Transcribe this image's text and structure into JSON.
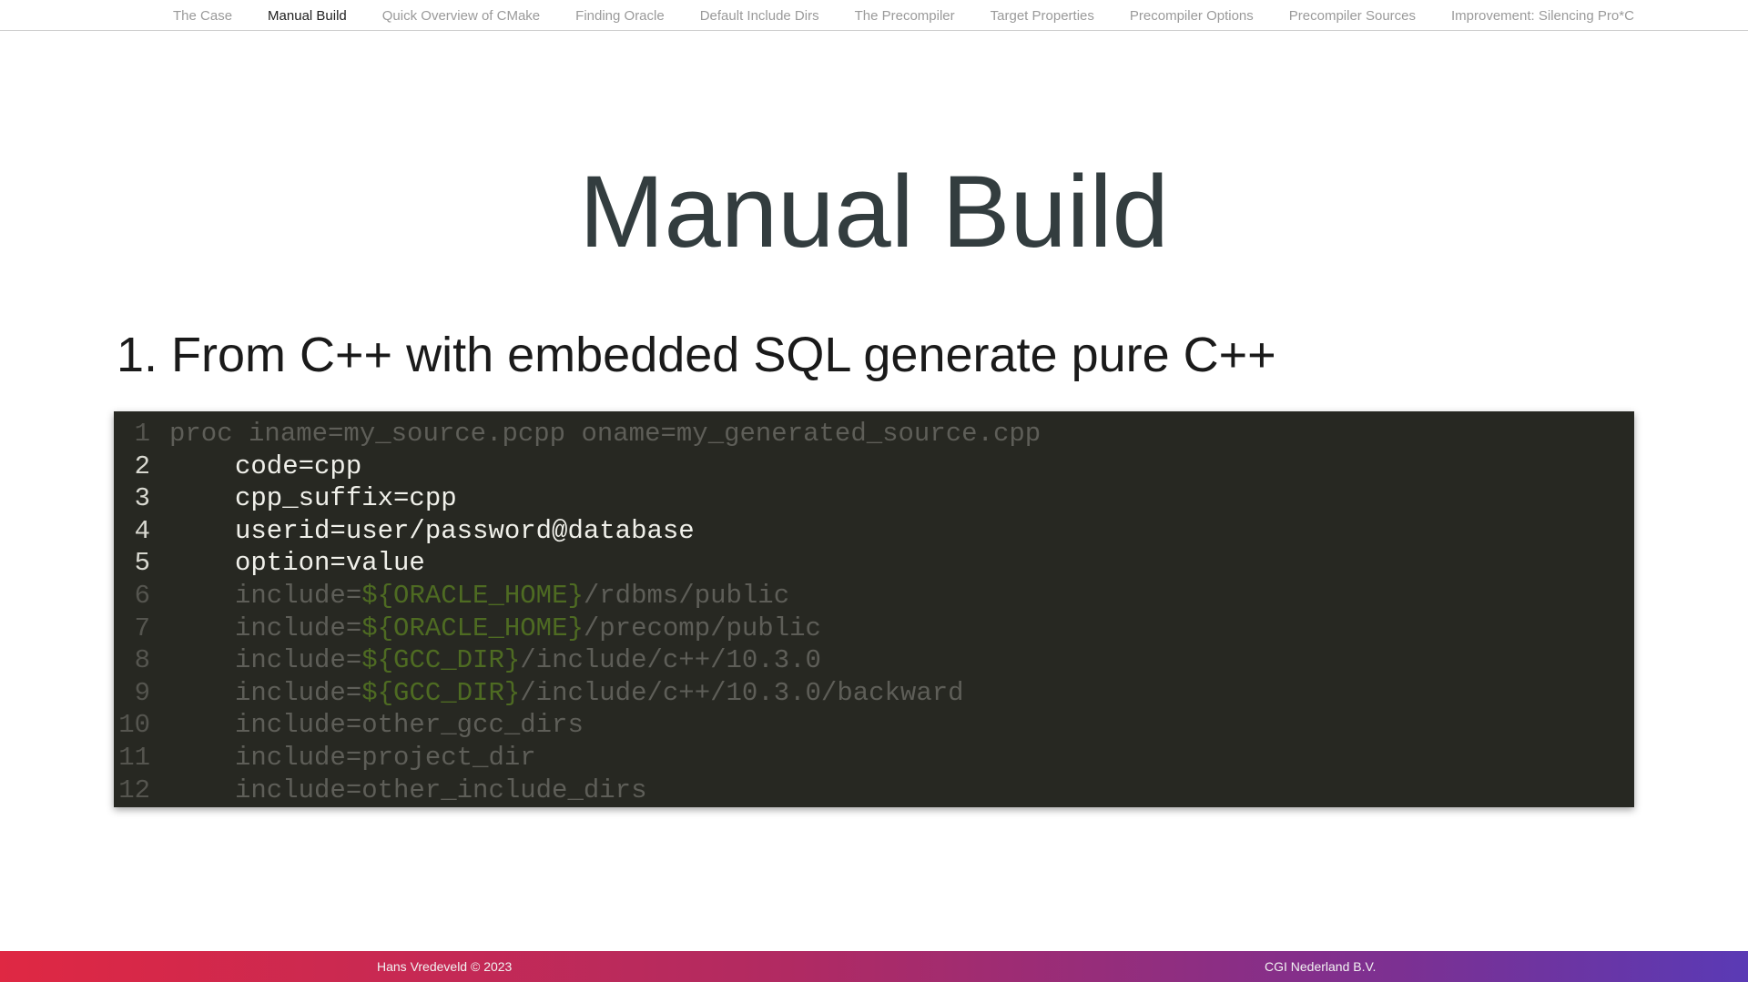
{
  "nav": {
    "items": [
      {
        "label": "The Case",
        "active": false
      },
      {
        "label": "Manual Build",
        "active": true
      },
      {
        "label": "Quick Overview of CMake",
        "active": false
      },
      {
        "label": "Finding Oracle",
        "active": false
      },
      {
        "label": "Default Include Dirs",
        "active": false
      },
      {
        "label": "The Precompiler",
        "active": false
      },
      {
        "label": "Target Properties",
        "active": false
      },
      {
        "label": "Precompiler Options",
        "active": false
      },
      {
        "label": "Precompiler Sources",
        "active": false
      },
      {
        "label": "Improvement: Silencing Pro*C",
        "active": false
      }
    ]
  },
  "slide": {
    "title": "Manual Build",
    "subtitle": "1. From C++ with embedded SQL generate pure C++"
  },
  "code": {
    "lines": [
      {
        "num": "1",
        "indent": false,
        "emphasis": "dim",
        "text": "proc iname=my_source.pcpp oname=my_generated_source.cpp",
        "var": "",
        "rest": ""
      },
      {
        "num": "2",
        "indent": true,
        "emphasis": "bright",
        "text": "code=cpp",
        "var": "",
        "rest": ""
      },
      {
        "num": "3",
        "indent": true,
        "emphasis": "bright",
        "text": "cpp_suffix=cpp",
        "var": "",
        "rest": ""
      },
      {
        "num": "4",
        "indent": true,
        "emphasis": "bright",
        "text": "userid=user/password@database",
        "var": "",
        "rest": ""
      },
      {
        "num": "5",
        "indent": true,
        "emphasis": "bright",
        "text": "option=value",
        "var": "",
        "rest": ""
      },
      {
        "num": "6",
        "indent": true,
        "emphasis": "dim",
        "text": "include=",
        "var": "${ORACLE_HOME}",
        "rest": "/rdbms/public"
      },
      {
        "num": "7",
        "indent": true,
        "emphasis": "dim",
        "text": "include=",
        "var": "${ORACLE_HOME}",
        "rest": "/precomp/public"
      },
      {
        "num": "8",
        "indent": true,
        "emphasis": "dim",
        "text": "include=",
        "var": "${GCC_DIR}",
        "rest": "/include/c++/10.3.0"
      },
      {
        "num": "9",
        "indent": true,
        "emphasis": "dim",
        "text": "include=",
        "var": "${GCC_DIR}",
        "rest": "/include/c++/10.3.0/backward"
      },
      {
        "num": "10",
        "indent": true,
        "emphasis": "dim",
        "text": "include=other_gcc_dirs",
        "var": "",
        "rest": ""
      },
      {
        "num": "11",
        "indent": true,
        "emphasis": "dim",
        "text": "include=project_dir",
        "var": "",
        "rest": ""
      },
      {
        "num": "12",
        "indent": true,
        "emphasis": "dim",
        "text": "include=other_include_dirs",
        "var": "",
        "rest": ""
      }
    ]
  },
  "footer": {
    "left": "Hans Vredeveld © 2023",
    "right": "CGI Nederland B.V."
  },
  "colors": {
    "code_background": "#272822",
    "variable": "#4e6b22",
    "footer_gradient_start": "#df2843",
    "footer_gradient_end": "#5a3ab5"
  }
}
